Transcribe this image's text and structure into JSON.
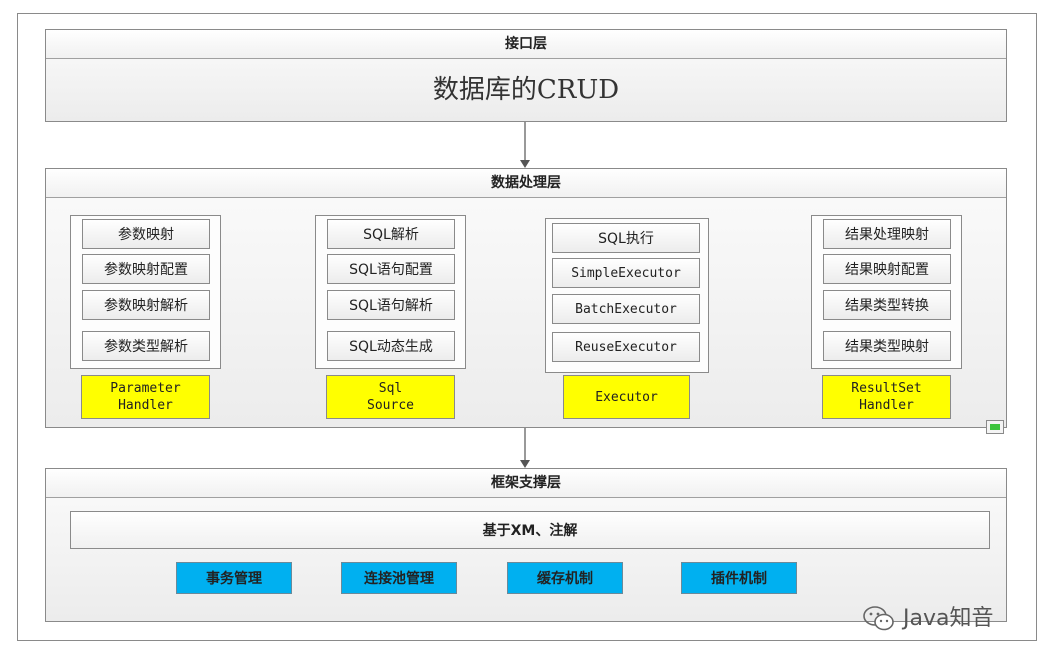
{
  "layers": {
    "interface": {
      "title": "接口层",
      "content": "数据库的CRUD"
    },
    "processing": {
      "title": "数据处理层",
      "groups": [
        {
          "items": [
            "参数映射",
            "参数映射配置",
            "参数映射解析",
            "参数类型解析"
          ],
          "label": "Parameter\nHandler"
        },
        {
          "items": [
            "SQL解析",
            "SQL语句配置",
            "SQL语句解析",
            "SQL动态生成"
          ],
          "label": "Sql\nSource"
        },
        {
          "items": [
            "SQL执行",
            "SimpleExecutor",
            "BatchExecutor",
            "ReuseExecutor"
          ],
          "label": "Executor"
        },
        {
          "items": [
            "结果处理映射",
            "结果映射配置",
            "结果类型转换",
            "结果类型映射"
          ],
          "label": "ResultSet\nHandler"
        }
      ]
    },
    "framework": {
      "title": "框架支撑层",
      "bar": "基于XM、注解",
      "modules": [
        "事务管理",
        "连接池管理",
        "缓存机制",
        "插件机制"
      ]
    }
  },
  "watermark": "Java知音",
  "colors": {
    "highlight": "#ffff00",
    "module": "#00b0f0"
  }
}
